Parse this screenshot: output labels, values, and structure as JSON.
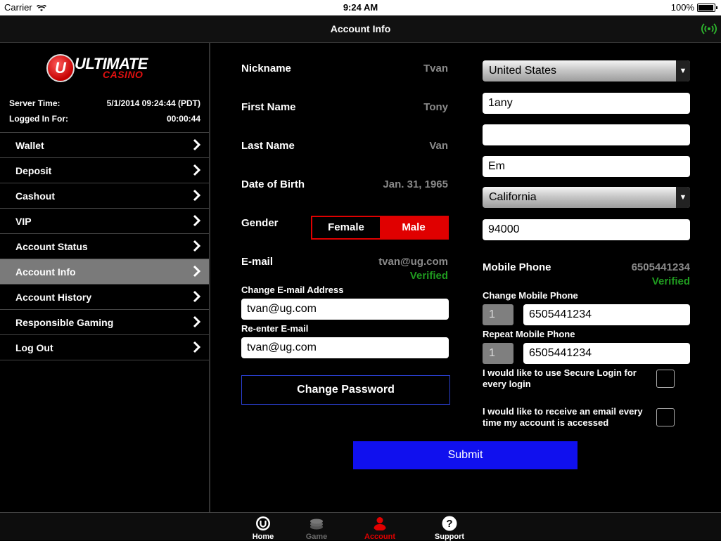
{
  "status_bar": {
    "carrier": "Carrier",
    "time": "9:24 AM",
    "battery": "100%"
  },
  "header": {
    "title": "Account Info",
    "signal_icon": "connection-icon"
  },
  "sidebar": {
    "logo_line1": "ULTIMATE",
    "logo_line2": "CASINO",
    "logo_badge": "U",
    "server_time_label": "Server Time:",
    "server_time_value": "5/1/2014 09:24:44 (PDT)",
    "logged_in_label": "Logged In For:",
    "logged_in_value": "00:00:44",
    "items": [
      {
        "label": "Wallet"
      },
      {
        "label": "Deposit"
      },
      {
        "label": "Cashout"
      },
      {
        "label": "VIP"
      },
      {
        "label": "Account Status"
      },
      {
        "label": "Account Info"
      },
      {
        "label": "Account History"
      },
      {
        "label": "Responsible Gaming"
      },
      {
        "label": "Log Out"
      }
    ],
    "active_index": 5
  },
  "form": {
    "nickname_label": "Nickname",
    "nickname_value": "Tvan",
    "first_name_label": "First Name",
    "first_name_value": "Tony",
    "last_name_label": "Last Name",
    "last_name_value": "Van",
    "dob_label": "Date of Birth",
    "dob_value": "Jan. 31, 1965",
    "gender_label": "Gender",
    "gender_female": "Female",
    "gender_male": "Male",
    "gender_selected": "Male",
    "email_label": "E-mail",
    "email_value": "tvan@ug.com",
    "email_status": "Verified",
    "change_email_label": "Change E-mail Address",
    "change_email_value": "tvan@ug.com",
    "reenter_email_label": "Re-enter E-mail",
    "reenter_email_value": "tvan@ug.com",
    "change_password_label": "Change Password",
    "country_value": "United States",
    "address1_value": "1any",
    "address2_value": "",
    "city_value": "Em",
    "state_value": "California",
    "zip_value": "94000",
    "mobile_label": "Mobile Phone",
    "mobile_value": "6505441234",
    "mobile_status": "Verified",
    "change_mobile_label": "Change Mobile Phone",
    "change_mobile_code": "1",
    "change_mobile_value": "6505441234",
    "repeat_mobile_label": "Repeat Mobile Phone",
    "repeat_mobile_code": "1",
    "repeat_mobile_value": "6505441234",
    "secure_login_label": "I would like to use Secure Login for every login",
    "email_notify_label": "I would like to receive an email every time my account is accessed",
    "submit_label": "Submit"
  },
  "tabbar": {
    "tabs": [
      {
        "label": "Home",
        "icon": "home-icon",
        "color": "#ffffff"
      },
      {
        "label": "Game",
        "icon": "chips-icon",
        "color": "#6a6a6a"
      },
      {
        "label": "Account",
        "icon": "person-icon",
        "color": "#e00000"
      },
      {
        "label": "Support",
        "icon": "question-icon",
        "color": "#ffffff"
      }
    ],
    "active": "Account"
  },
  "colors": {
    "accent_red": "#e00000",
    "verified_green": "#1f9a1f",
    "submit_blue": "#1010ee"
  }
}
